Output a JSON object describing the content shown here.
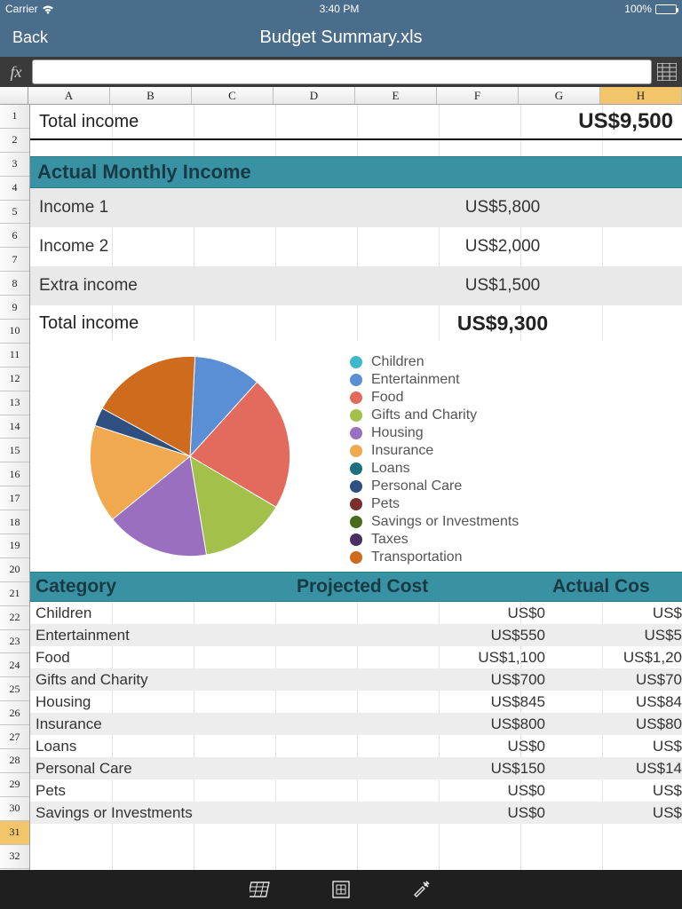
{
  "status": {
    "carrier": "Carrier",
    "time": "3:40 PM",
    "battery": "100%"
  },
  "nav": {
    "back": "Back",
    "title": "Budget Summary.xls"
  },
  "formula": {
    "fx": "fx",
    "value": ""
  },
  "columns": [
    "A",
    "B",
    "C",
    "D",
    "E",
    "F",
    "G",
    "H"
  ],
  "selected_col_index": 7,
  "row_numbers": [
    1,
    2,
    3,
    4,
    5,
    6,
    7,
    8,
    9,
    10,
    11,
    12,
    13,
    14,
    15,
    16,
    17,
    18,
    19,
    20,
    21,
    22,
    23,
    24,
    25,
    26,
    27,
    28,
    29,
    30,
    31,
    32
  ],
  "selected_row_index": 30,
  "top": {
    "total_income_label": "Total income",
    "total_income_value": "US$9,500"
  },
  "section_ami": "Actual Monthly Income",
  "income": [
    {
      "label": "Income 1",
      "value": "US$5,800"
    },
    {
      "label": "Income 2",
      "value": "US$2,000"
    },
    {
      "label": "Extra income",
      "value": "US$1,500"
    }
  ],
  "income_total": {
    "label": "Total income",
    "value": "US$9,300"
  },
  "chart_data": {
    "type": "pie",
    "title": "",
    "series": [
      {
        "name": "Children",
        "value": 0,
        "color": "#3fb8c9"
      },
      {
        "name": "Entertainment",
        "value": 550,
        "color": "#5a8fd6"
      },
      {
        "name": "Food",
        "value": 1100,
        "color": "#e26b5d"
      },
      {
        "name": "Gifts and Charity",
        "value": 700,
        "color": "#a3c14a"
      },
      {
        "name": "Housing",
        "value": 845,
        "color": "#9b6fc0"
      },
      {
        "name": "Insurance",
        "value": 800,
        "color": "#f0a94e"
      },
      {
        "name": "Loans",
        "value": 0,
        "color": "#1f6f80"
      },
      {
        "name": "Personal Care",
        "value": 150,
        "color": "#2f4f80"
      },
      {
        "name": "Pets",
        "value": 0,
        "color": "#7b2f2a"
      },
      {
        "name": "Savings or Investments",
        "value": 0,
        "color": "#4a6b1e"
      },
      {
        "name": "Taxes",
        "value": 0,
        "color": "#4a2f63"
      },
      {
        "name": "Transportation",
        "value": 900,
        "color": "#cf6b1c"
      }
    ]
  },
  "cat_headers": {
    "c1": "Category",
    "c2": "Projected Cost",
    "c3": "Actual Cos"
  },
  "cat_rows": [
    {
      "c1": "Children",
      "c2": "US$0",
      "c3": "US$",
      "alt": false
    },
    {
      "c1": "Entertainment",
      "c2": "US$550",
      "c3": "US$5",
      "alt": true
    },
    {
      "c1": "Food",
      "c2": "US$1,100",
      "c3": "US$1,20",
      "alt": false
    },
    {
      "c1": "Gifts and Charity",
      "c2": "US$700",
      "c3": "US$70",
      "alt": true
    },
    {
      "c1": "Housing",
      "c2": "US$845",
      "c3": "US$84",
      "alt": false
    },
    {
      "c1": "Insurance",
      "c2": "US$800",
      "c3": "US$80",
      "alt": true
    },
    {
      "c1": "Loans",
      "c2": "US$0",
      "c3": "US$",
      "alt": false
    },
    {
      "c1": "Personal Care",
      "c2": "US$150",
      "c3": "US$14",
      "alt": true
    },
    {
      "c1": "Pets",
      "c2": "US$0",
      "c3": "US$",
      "alt": false
    },
    {
      "c1": "Savings or Investments",
      "c2": "US$0",
      "c3": "US$",
      "alt": true
    }
  ]
}
